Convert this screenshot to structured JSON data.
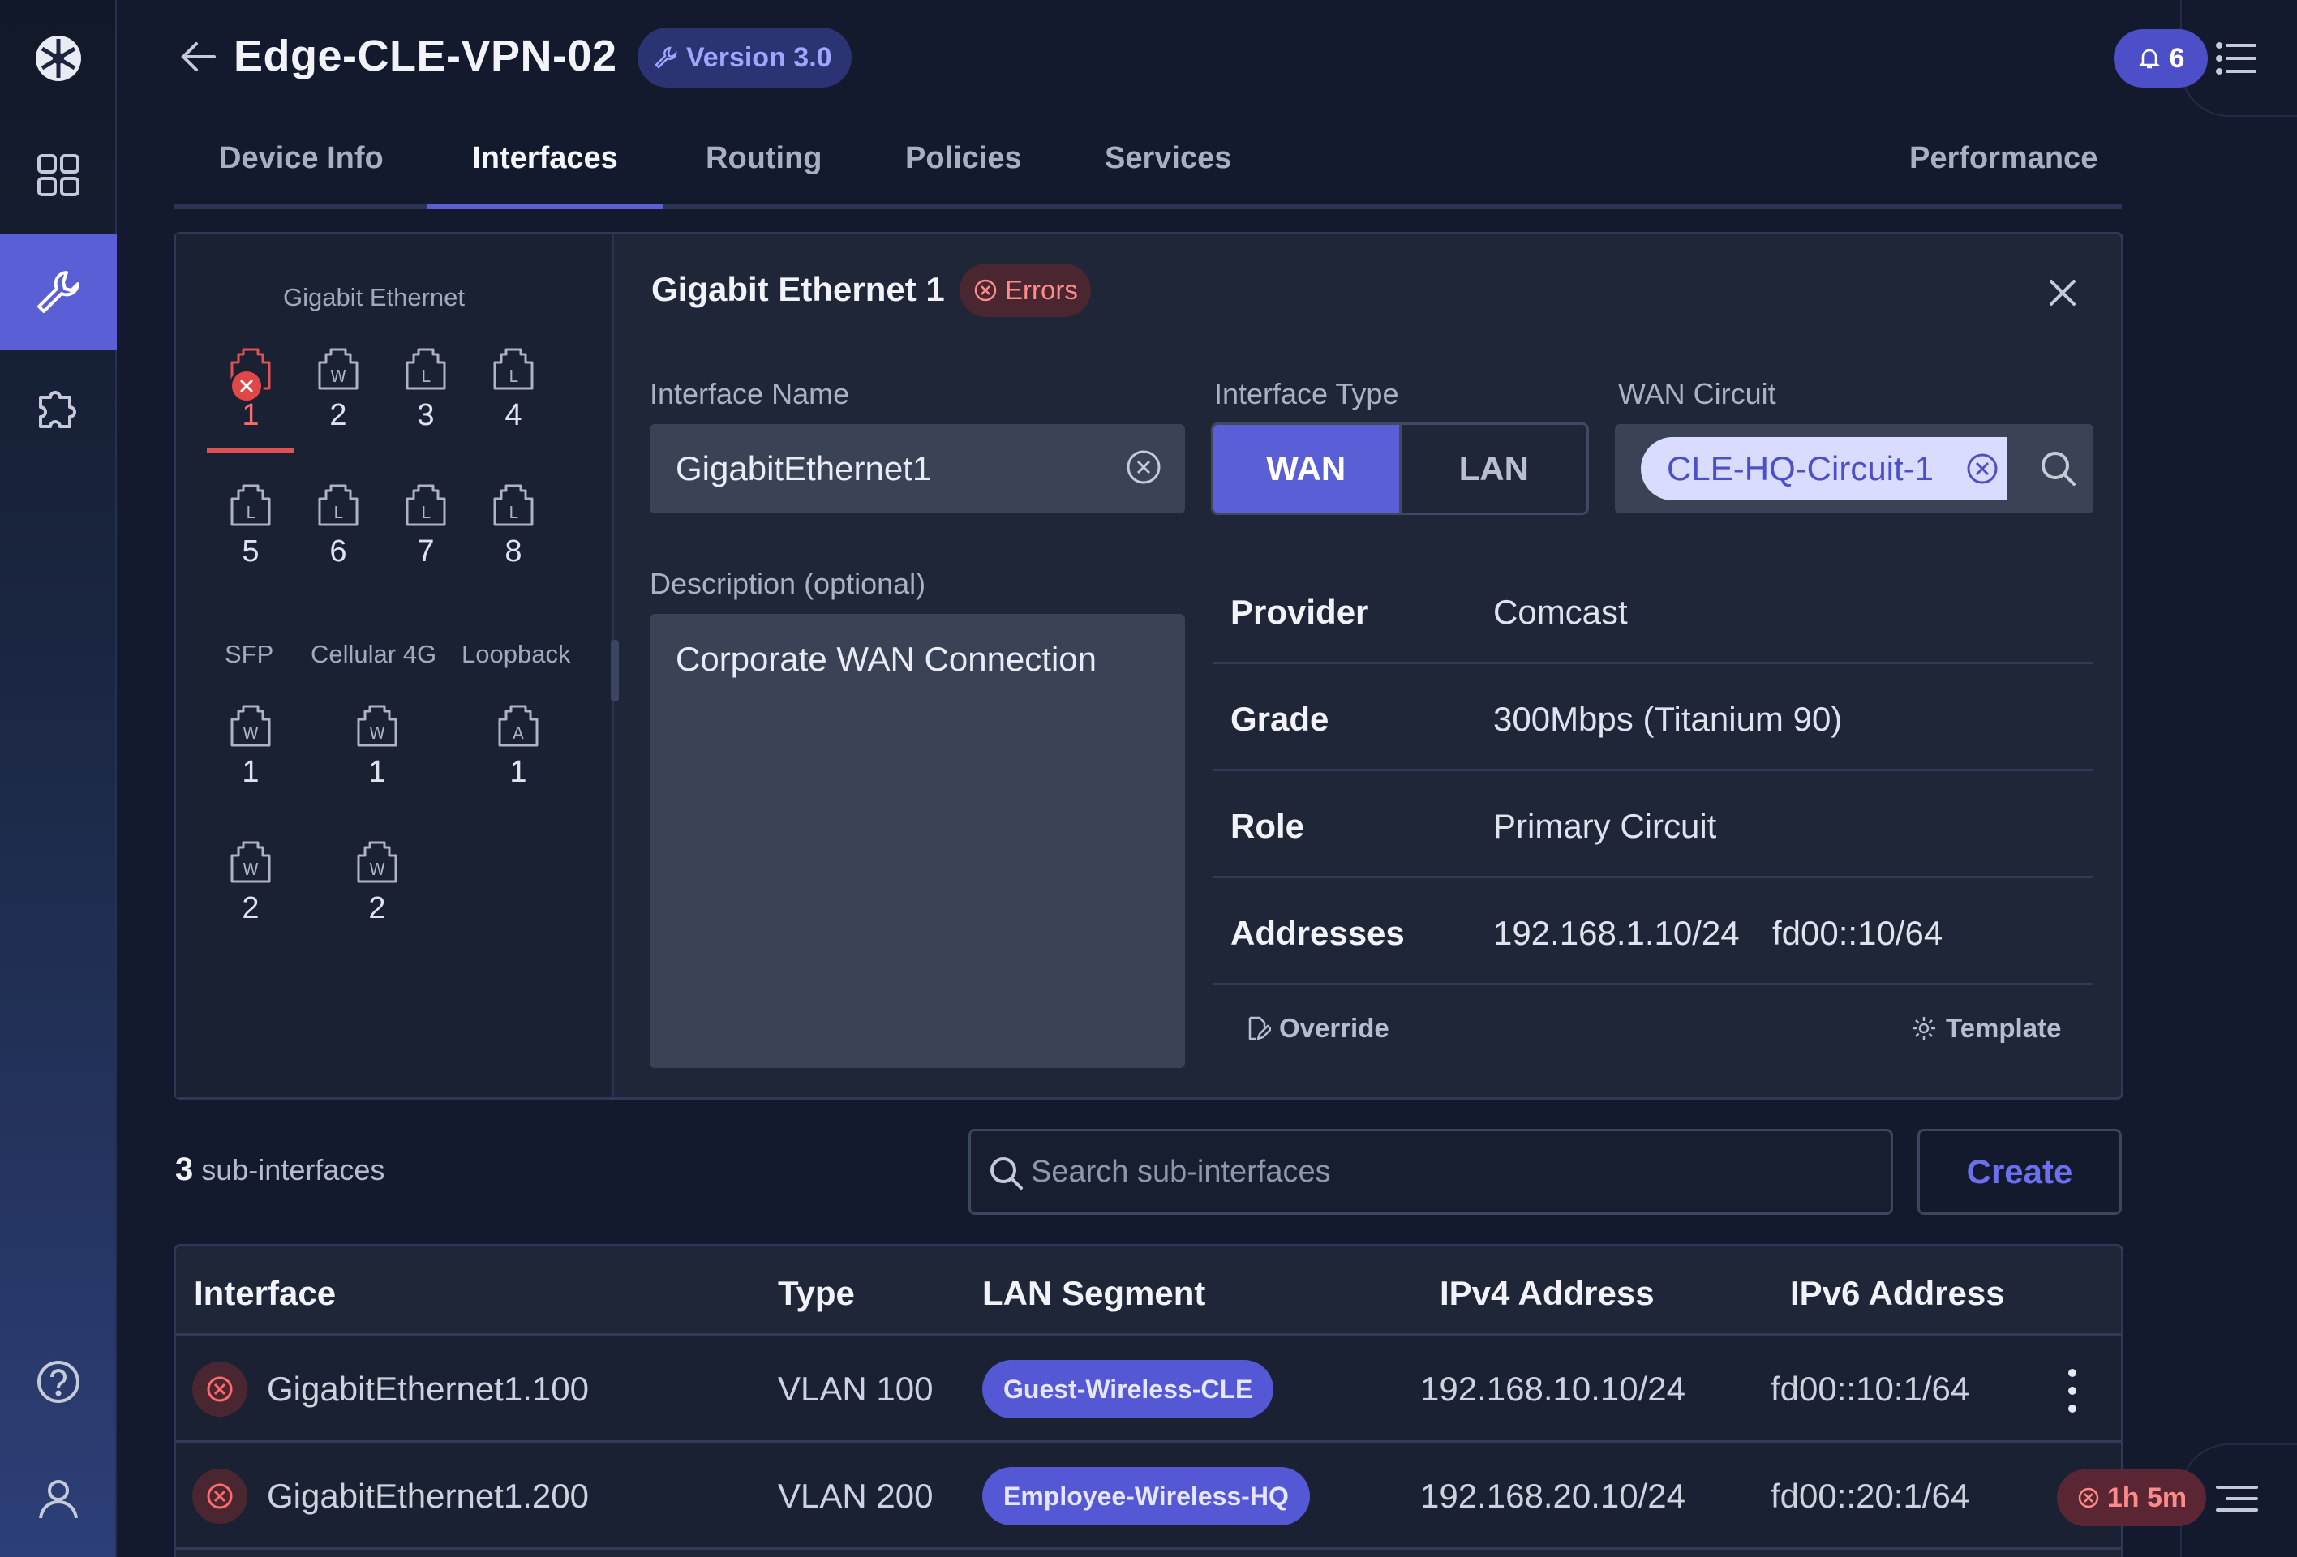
{
  "header": {
    "title": "Edge-CLE-VPN-02",
    "version": "Version 3.0",
    "notifications": "6"
  },
  "tabs": [
    {
      "label": "Device Info"
    },
    {
      "label": "Interfaces"
    },
    {
      "label": "Routing"
    },
    {
      "label": "Policies"
    },
    {
      "label": "Services"
    },
    {
      "label": "Performance"
    }
  ],
  "ports": {
    "gigabit_label": "Gigabit Ethernet",
    "gigabit": [
      {
        "num": "1",
        "glyph": "",
        "error": true
      },
      {
        "num": "2",
        "glyph": "W"
      },
      {
        "num": "3",
        "glyph": "L"
      },
      {
        "num": "4",
        "glyph": "L"
      },
      {
        "num": "5",
        "glyph": "L"
      },
      {
        "num": "6",
        "glyph": "L"
      },
      {
        "num": "7",
        "glyph": "L"
      },
      {
        "num": "8",
        "glyph": "L"
      }
    ],
    "sfp_label": "SFP",
    "cellular_label": "Cellular 4G",
    "loopback_label": "Loopback",
    "sfp": [
      {
        "num": "1",
        "glyph": "W"
      },
      {
        "num": "2",
        "glyph": "W"
      }
    ],
    "cellular": [
      {
        "num": "1",
        "glyph": "W"
      },
      {
        "num": "2",
        "glyph": "W"
      }
    ],
    "loopback": [
      {
        "num": "1",
        "glyph": "A"
      }
    ]
  },
  "detail": {
    "title": "Gigabit Ethernet 1",
    "status": "Errors",
    "interface_name_label": "Interface Name",
    "interface_name_value": "GigabitEthernet1",
    "interface_type_label": "Interface Type",
    "type_options": [
      "WAN",
      "LAN"
    ],
    "type_selected": "WAN",
    "wan_circuit_label": "WAN Circuit",
    "wan_circuit_value": "CLE-HQ-Circuit-1",
    "description_label": "Description (optional)",
    "description_value": "Corporate WAN Connection",
    "info": [
      {
        "key": "Provider",
        "value": "Comcast"
      },
      {
        "key": "Grade",
        "value": "300Mbps (Titanium 90)"
      },
      {
        "key": "Role",
        "value": "Primary Circuit"
      },
      {
        "key": "Addresses",
        "value": "192.168.1.10/24",
        "value2": "fd00::10/64"
      }
    ],
    "override_label": "Override",
    "template_label": "Template"
  },
  "subinterfaces": {
    "count": "3",
    "count_suffix": "sub-interfaces",
    "search_placeholder": "Search sub-interfaces",
    "create_label": "Create",
    "columns": [
      "Interface",
      "Type",
      "LAN Segment",
      "IPv4 Address",
      "IPv6 Address"
    ],
    "rows": [
      {
        "interface": "GigabitEthernet1.100",
        "type": "VLAN 100",
        "segment": "Guest-Wireless-CLE",
        "ipv4": "192.168.10.10/24",
        "ipv6": "fd00::10:1/64"
      },
      {
        "interface": "GigabitEthernet1.200",
        "type": "VLAN 200",
        "segment": "Employee-Wireless-HQ",
        "ipv4": "192.168.20.10/24",
        "ipv6": "fd00::20:1/64"
      }
    ]
  },
  "timer": "1h 5m",
  "colors": {
    "accent": "#5b5fd6",
    "error": "#e04848",
    "background": "#131a2e"
  }
}
